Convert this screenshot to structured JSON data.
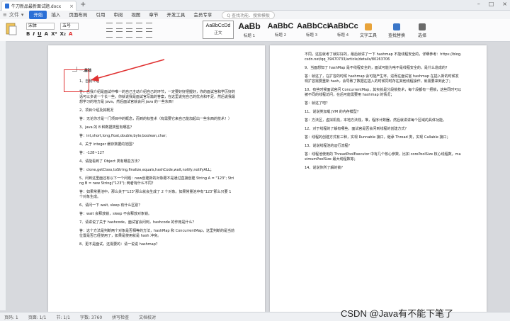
{
  "titlebar": {
    "tab_title": "牛刀新品最新面试题.docx",
    "close": "×",
    "new_tab": "+",
    "controls": [
      "–",
      "□",
      "×"
    ]
  },
  "menubar": {
    "left_icons": [
      "≡",
      "文件",
      "▾"
    ],
    "items": [
      "开始",
      "插入",
      "页面布局",
      "引用",
      "审阅",
      "视图",
      "章节",
      "开发工具",
      "会员专享"
    ],
    "active": "开始",
    "search": "Q 查找功能、搜索模板"
  },
  "ribbon": {
    "font_name": "宋体",
    "font_size": "五号",
    "format_buttons": [
      "B",
      "I",
      "U",
      "A",
      "X²",
      "X₂",
      "A"
    ],
    "styles": [
      {
        "sample": "AaBbCcDd",
        "name": "正文"
      },
      {
        "sample": "AaBb",
        "name": "标题 1"
      },
      {
        "sample": "AaBbC",
        "name": "标题 2"
      },
      {
        "sample": "AaBbCcI",
        "name": "标题 3"
      },
      {
        "sample": "AaBbCc",
        "name": "标题 4"
      }
    ],
    "right_tools": [
      {
        "label": "文字工具",
        "color": "#e8a33a"
      },
      {
        "label": "查找替换",
        "color": "#3a76c8"
      },
      {
        "label": "选择",
        "color": "#6a6a6a"
      }
    ]
  },
  "left_page": {
    "paragraphs": [
      "一.基础",
      "1、自我介绍",
      "答：自我介绍是面试中唯一的自己主动介绍自己的环节，一定要好好把握好，你的面试官和学历好的话可以多说一个长一些，你就说我是面试官写篇的答案，在这里说完自己的优点和不足，然后说我最想学习的地方是 java，然后面试官就会问 java 的一些东西！",
      "2、项目介绍及其概况",
      "答：无论你才是一门项目中的概念，而到的标签术（有需要它来自己能加起出一些东西的技术！）",
      "3、java 的 8 种数据类型有哪些？",
      "答：int,short,long,float,double,byte,boolean,char;",
      "4、关于 integer 缓存数据的范围？",
      "答：-128~127",
      "4、请能看到了 Object 类有哪些方法？",
      "答：clone,getClass,toString,finalize,equals,hashCode,wait,notify,notifyALL；",
      "5、问到这里面还有以下一个问题：new创建新的对象跟不是通过直接创建 String A = \"123\"; String B = new String(\"123\"); 两者有什么不同？",
      "答：如果常量池中，那么关于\"123\"那么就会生成了 2 个对象。如果常量池中有\"123\"那么只要 1 个对象生成。",
      "6、请问一下 wait, sleep 有什么区别？",
      "答：wait 会释放锁，sleep 不会释放对象锁。",
      "7、请讲说了关于 hashcode，面试官会问到，hashcode 的作用是什么？",
      "答：这个方法是判断两个对象是否相等的方法，hashMap 和 ConcurrentMap，这里判断的是当前位置是否已经使用了，如果是使用就是 hash 冲突。",
      "8、更不是面试，还需要的：请一说说 hashmap？"
    ]
  },
  "right_page": {
    "paragraphs": [
      "不同，这些就考了就好好的，最后就讲了一下 hashmap 不能线程安全的，详细参考：https://blog.csdn.net/qq_39470733/article/details/80263706",
      "9、当面想知了 hashMap 是不线程安全的，面试可能为啥不是线程安全的，是什么造成的？",
      "答：就这了，在扩容的时候 hashmap 会可能产生环，进而在面试官 hashmap 在插入新的时候发现扩容需要重新 hash，会导致了数据在插入的时候同时存在其他线程操作，就需要来到此了；",
      "10、有些时候面试官问 ConcurrentMap，其实就是分段锁技术，每个段都有一把锁，这些同时可以被不同的线程访问，在后可能需要用 hashmap 的情况；",
      "答：就这了吧？",
      "11、说说类加载 JVM 的内存模型？",
      "答：方法区，虚拟机栈，本地方法栈，堆，程序计数器，然后就讲讲每个区域的具体功能，",
      "12、对于线程的了解有哪些，面试官是否会问到线程的创建方式？",
      "答：线程的创建方式有三种，实现 Runnable 接口，继承 Thread 类，实现 Callable 接口；",
      "13、说说线程池的运行流程？",
      "答：线程池使用的 ThreadPoolExecutor 中有几个核心参数，比如 corePoolSize 核心线程数，maximumPoolSize 最大线程数等；",
      "14、说说你所了解的锁？"
    ]
  },
  "status": {
    "items": [
      "页码: 1",
      "页面: 1/1",
      "节: 1/1",
      "字数: 3760",
      "拼写检查",
      "文档校对"
    ]
  },
  "watermark": "CSDN @Java有不能下笔了"
}
